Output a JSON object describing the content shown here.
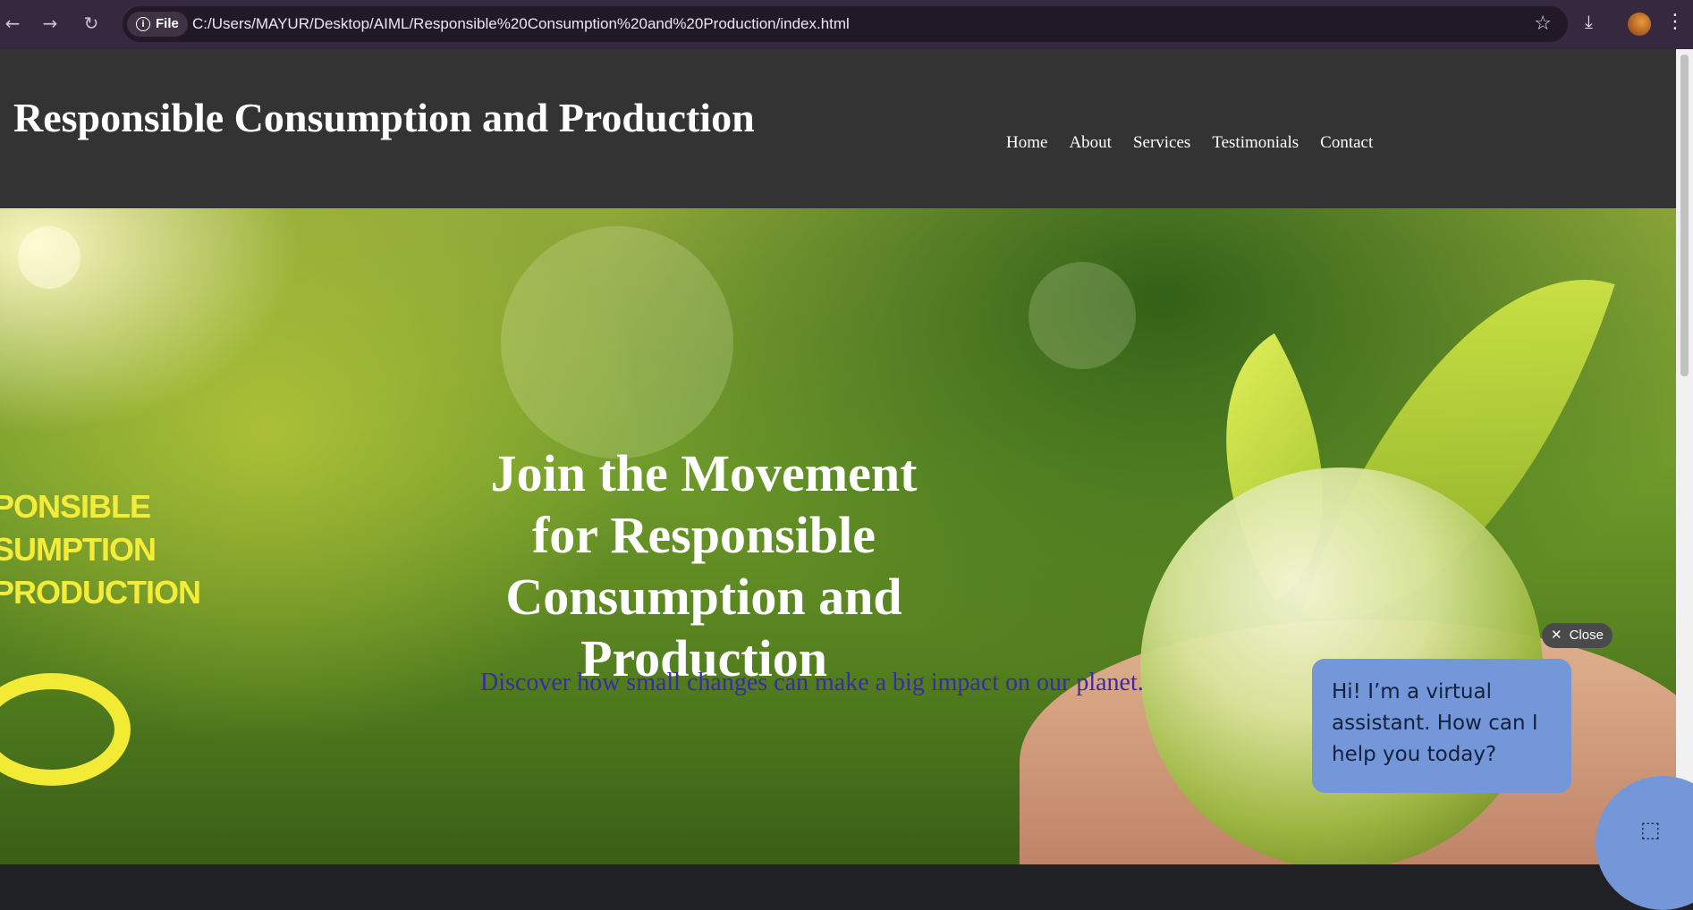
{
  "browser": {
    "back_icon": "arrow-left-icon",
    "forward_icon": "arrow-right-icon",
    "reload_icon": "reload-icon",
    "site_chip_label": "File",
    "url": "C:/Users/MAYUR/Desktop/AIML/Responsible%20Consumption%20and%20Production/index.html"
  },
  "header": {
    "title": "Responsible Consumption and Production",
    "nav": [
      "Home",
      "About",
      "Services",
      "Testimonials",
      "Contact"
    ]
  },
  "hero": {
    "watermark_lines": [
      "PONSIBLE",
      "SUMPTION",
      "PRODUCTION"
    ],
    "heading": "Join the Movement for Responsible Consumption and Production",
    "subheading": "Discover how small changes can make a big impact on our planet."
  },
  "chat": {
    "close_label": "Close",
    "message": "Hi! I’m a virtual assistant. How can I help you today?",
    "accent_color": "#7497d9"
  }
}
